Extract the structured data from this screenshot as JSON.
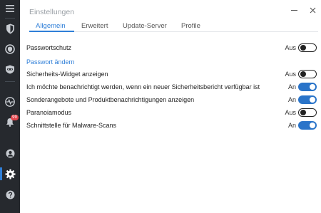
{
  "window": {
    "title": "Einstellungen",
    "minimize_icon": "minimize-icon",
    "close_icon": "close-icon"
  },
  "sidebar": {
    "items": [
      {
        "id": "menu",
        "icon": "hamburger-menu-icon"
      },
      {
        "id": "protection",
        "icon": "shield-icon"
      },
      {
        "id": "browser-guard",
        "icon": "browser-guard-icon"
      },
      {
        "id": "privacy",
        "icon": "privacy-mask-icon"
      },
      {
        "id": "activity",
        "icon": "activity-pulse-icon"
      },
      {
        "id": "notifications",
        "icon": "bell-icon",
        "badge": "99"
      },
      {
        "id": "account",
        "icon": "user-icon"
      },
      {
        "id": "settings",
        "icon": "gear-icon",
        "active": true
      },
      {
        "id": "help",
        "icon": "help-icon"
      }
    ]
  },
  "tabs": [
    {
      "label": "Allgemein",
      "active": true
    },
    {
      "label": "Erweitert",
      "active": false
    },
    {
      "label": "Update-Server",
      "active": false
    },
    {
      "label": "Profile",
      "active": false
    }
  ],
  "settings": {
    "password_protection": {
      "label": "Passwortschutz",
      "state": "Aus",
      "on": false
    },
    "change_password_link": "Passwort ändern",
    "security_widget": {
      "label": "Sicherheits-Widget anzeigen",
      "state": "Aus",
      "on": false
    },
    "security_report": {
      "label": "Ich möchte benachrichtigt werden, wenn ein neuer Sicherheitsbericht verfügbar ist",
      "state": "An",
      "on": true
    },
    "special_offers": {
      "label": "Sonderangebote und Produktbenachrichtigungen anzeigen",
      "state": "An",
      "on": true
    },
    "paranoia_mode": {
      "label": "Paranoiamodus",
      "state": "Aus",
      "on": false
    },
    "malware_scan_interface": {
      "label": "Schnittstelle für Malware-Scans",
      "state": "An",
      "on": true
    }
  },
  "colors": {
    "sidebar_bg": "#26292e",
    "accent": "#2f7fd8",
    "toggle_on": "#2a74c9",
    "badge": "#e2444b"
  }
}
